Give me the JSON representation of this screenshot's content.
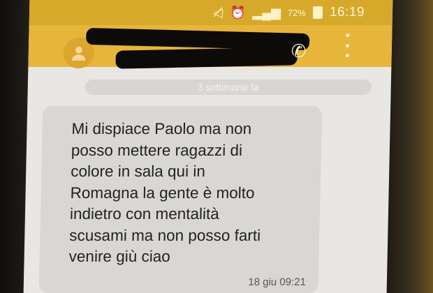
{
  "status_bar": {
    "battery_percent": "72%",
    "time": "16:19",
    "icons": [
      "mute-icon",
      "alarm-icon",
      "signal-icon",
      "battery-icon"
    ]
  },
  "app_bar": {
    "contact_name": "",
    "icons": [
      "contact-avatar-icon",
      "call-icon",
      "overflow-menu-icon"
    ]
  },
  "conversation": {
    "date_separator": "3 settimane fa",
    "messages": [
      {
        "text": "Mi dispiace Paolo ma non\nposso mettere ragazzi di\ncolore in sala qui in\nRomagna la gente è molto\nindietro con mentalità\nscusami ma non posso farti\nvenire giù ciao",
        "timestamp": "18 giu 09:21"
      }
    ]
  },
  "colors": {
    "status_bar": "#d6a92a",
    "app_bar": "#e7b53a",
    "bubble": "#d9d7d4",
    "background": "#e9e7e4"
  }
}
